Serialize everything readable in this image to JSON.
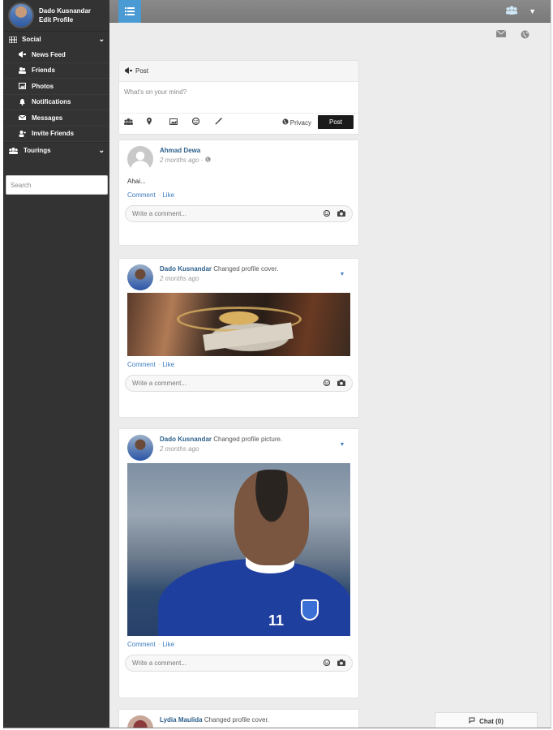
{
  "profile": {
    "name": "Dado Kusnandar",
    "edit_label": "Edit Profile"
  },
  "sidebar": {
    "sections": [
      {
        "label": "Social",
        "icon": "grid-icon"
      },
      {
        "label": "Tourings",
        "icon": "group-icon"
      }
    ],
    "items": [
      {
        "label": "News Feed",
        "icon": "megaphone-icon"
      },
      {
        "label": "Friends",
        "icon": "friends-icon"
      },
      {
        "label": "Photos",
        "icon": "photo-icon"
      },
      {
        "label": "Notifications",
        "icon": "bell-icon"
      },
      {
        "label": "Messages",
        "icon": "envelope-icon"
      },
      {
        "label": "Invite Friends",
        "icon": "invite-icon"
      }
    ],
    "search_placeholder": "Search"
  },
  "composer": {
    "title": "Post",
    "placeholder": "What's on your mind?",
    "privacy_label": "Privacy",
    "post_label": "Post"
  },
  "posts": [
    {
      "author": "Ahmad Dewa",
      "action": "",
      "time": "2 months ago · ",
      "text": "Ahai..."
    },
    {
      "author": "Dado Kusnandar",
      "action": " Changed profile cover.",
      "time": "2 months ago",
      "text": ""
    },
    {
      "author": "Dado Kusnandar",
      "action": " Changed profile picture.",
      "time": "2 months ago",
      "text": ""
    },
    {
      "author": "Lydia Maulida",
      "action": " Changed profile cover.",
      "time": "",
      "text": ""
    }
  ],
  "post_actions": {
    "comment": "Comment",
    "like": "Like",
    "separator": "·"
  },
  "comment_placeholder": "Write a comment...",
  "photo_number": "11",
  "chat": {
    "label": "Chat (0)"
  },
  "colors": {
    "sidebar": "#333333",
    "menu_button": "#4a9ad3",
    "link": "#3b7bbf",
    "main_bg": "#ececec"
  }
}
